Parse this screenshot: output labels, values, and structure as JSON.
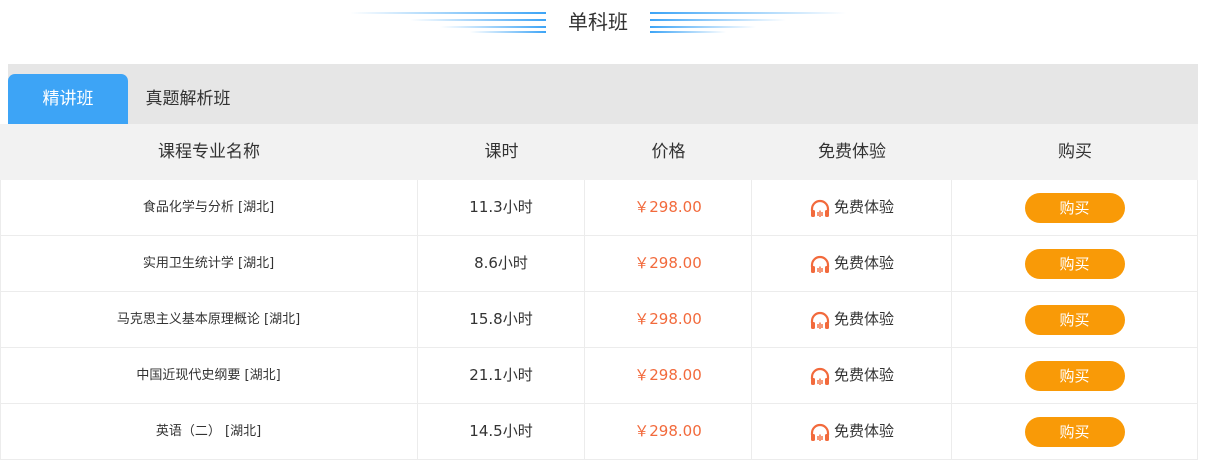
{
  "section": {
    "title": "单科班"
  },
  "tabs": [
    {
      "label": "精讲班",
      "active": true
    },
    {
      "label": "真题解析班",
      "active": false
    }
  ],
  "table": {
    "headers": [
      "课程专业名称",
      "课时",
      "价格",
      "免费体验",
      "购买"
    ],
    "rows": [
      {
        "name": "食品化学与分析 [湖北]",
        "hours": "11.3小时",
        "price": "￥298.00",
        "trial": "免费体验",
        "buy": "购买"
      },
      {
        "name": "实用卫生统计学 [湖北]",
        "hours": "8.6小时",
        "price": "￥298.00",
        "trial": "免费体验",
        "buy": "购买"
      },
      {
        "name": "马克思主义基本原理概论 [湖北]",
        "hours": "15.8小时",
        "price": "￥298.00",
        "trial": "免费体验",
        "buy": "购买"
      },
      {
        "name": "中国近现代史纲要 [湖北]",
        "hours": "21.1小时",
        "price": "￥298.00",
        "trial": "免费体验",
        "buy": "购买"
      },
      {
        "name": "英语（二） [湖北]",
        "hours": "14.5小时",
        "price": "￥298.00",
        "trial": "免费体验",
        "buy": "购买"
      }
    ]
  },
  "colors": {
    "tab_active": "#3da4f6",
    "price": "#f26a3c",
    "buy_button": "#f99a07",
    "headphone_icon": "#f26a3c"
  },
  "icons": {
    "trial": "headphone-icon"
  }
}
